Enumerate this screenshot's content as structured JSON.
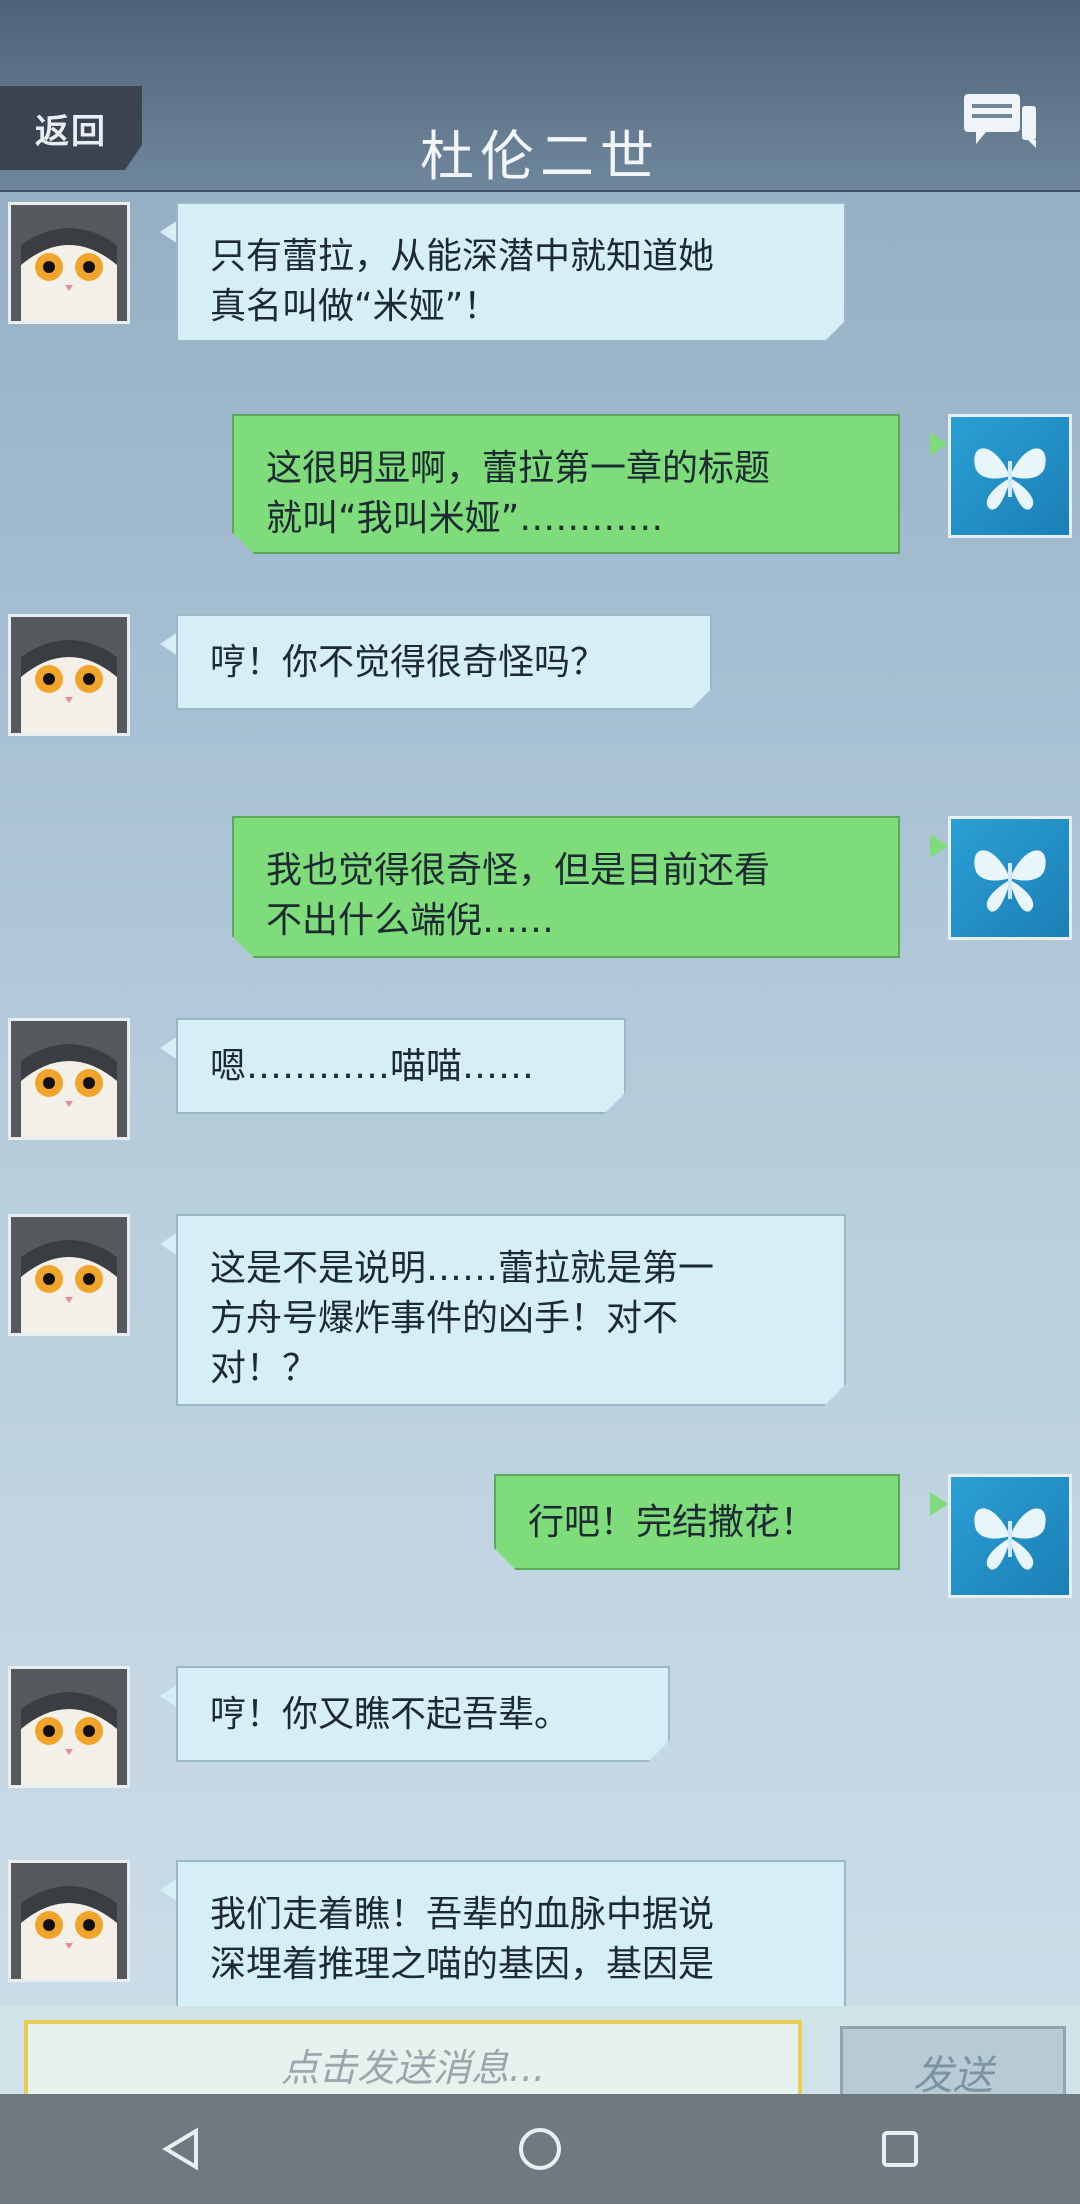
{
  "header": {
    "back_label": "返回",
    "title": "杜伦二世",
    "chat_icon": "chat-bubbles-icon"
  },
  "messages": [
    {
      "side": "in",
      "avatar": "cat-avatar",
      "lines": [
        "只有蕾拉，从能深潜中就知道她",
        "真名叫做“米娅”！"
      ]
    },
    {
      "side": "out",
      "avatar": "butterfly-avatar",
      "lines": [
        "这很明显啊，蕾拉第一章的标题",
        "就叫“我叫米娅”…………"
      ]
    },
    {
      "side": "in",
      "avatar": "cat-avatar",
      "lines": [
        "哼！你不觉得很奇怪吗？"
      ]
    },
    {
      "side": "out",
      "avatar": "butterfly-avatar",
      "lines": [
        "我也觉得很奇怪，但是目前还看",
        "不出什么端倪……"
      ]
    },
    {
      "side": "in",
      "avatar": "cat-avatar",
      "lines": [
        "嗯…………喵喵……"
      ]
    },
    {
      "side": "in",
      "avatar": "cat-avatar",
      "lines": [
        "这是不是说明……蕾拉就是第一",
        "方舟号爆炸事件的凶手！对不",
        "对！？"
      ]
    },
    {
      "side": "out",
      "avatar": "butterfly-avatar",
      "lines": [
        "行吧！完结撒花！"
      ]
    },
    {
      "side": "in",
      "avatar": "cat-avatar",
      "lines": [
        "哼！你又瞧不起吾辈。"
      ]
    },
    {
      "side": "in",
      "avatar": "cat-avatar",
      "lines": [
        "我们走着瞧！吾辈的血脉中据说",
        "深埋着推理之喵的基因，基因是"
      ]
    }
  ],
  "input": {
    "placeholder": "点击发送消息..."
  },
  "send_label": "发送",
  "nav": {
    "back_icon": "nav-back-icon",
    "home_icon": "nav-home-icon",
    "recents_icon": "nav-recents-icon"
  }
}
